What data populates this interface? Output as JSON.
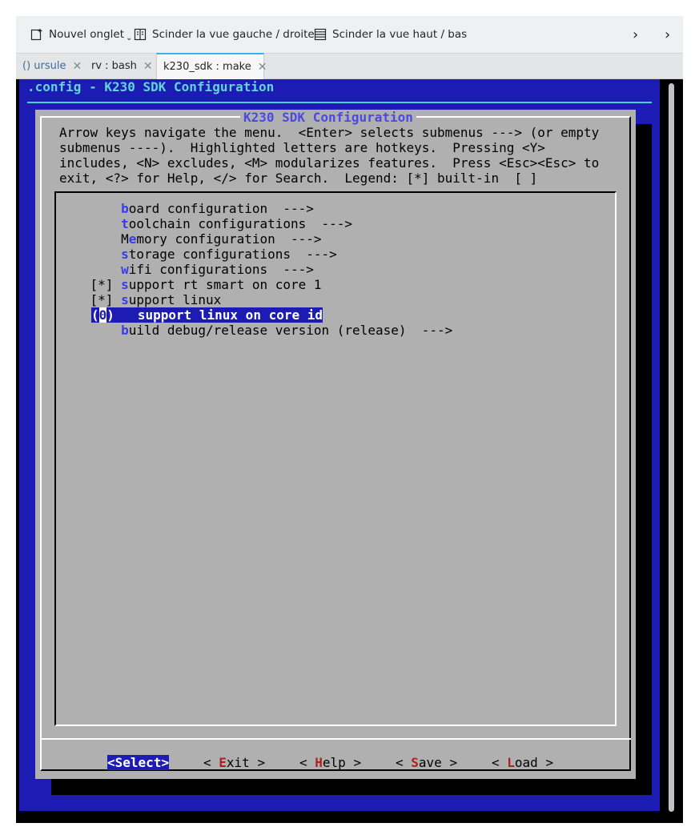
{
  "toolbar": {
    "new_tab": "Nouvel onglet",
    "new_tab_caret": "⌄",
    "split_lr": "Scinder la vue gauche / droite",
    "split_tb": "Scinder la vue haut / bas",
    "more_1": "›",
    "more_2": "›"
  },
  "tabs": [
    {
      "label": "() ursule",
      "close": "✕"
    },
    {
      "label": "rv : bash",
      "close": "✕"
    },
    {
      "label": "k230_sdk : make",
      "close": "✕"
    }
  ],
  "terminal": {
    "header_title": ".config - K230 SDK Configuration",
    "dialog_title": "K230 SDK Configuration",
    "help_lines": [
      "Arrow keys navigate the menu.  <Enter> selects submenus ---> (or empty",
      "submenus ----).  Highlighted letters are hotkeys.  Pressing <Y>",
      "includes, <N> excludes, <M> modularizes features.  Press <Esc><Esc> to",
      "exit, <?> for Help, </> for Search.  Legend: [*] built-in  [ ]"
    ],
    "menu_items": [
      {
        "prefix": "        ",
        "hotkey": "b",
        "rest": "oard configuration  --->"
      },
      {
        "prefix": "        ",
        "hotkey": "t",
        "rest": "oolchain configurations  --->"
      },
      {
        "prefix": "        M",
        "hotkey": "e",
        "rest": "mory configuration  --->"
      },
      {
        "prefix": "        ",
        "hotkey": "s",
        "rest": "torage configurations  --->"
      },
      {
        "prefix": "        ",
        "hotkey": "w",
        "rest": "ifi configurations  --->"
      },
      {
        "prefix": "    [*] ",
        "hotkey": "s",
        "rest": "upport rt smart on core 1"
      },
      {
        "prefix": "    [*] ",
        "hotkey": "s",
        "rest": "upport linux"
      },
      {
        "prefix": "    (",
        "cursor": "0",
        "mid": ")   ",
        "hotkey": "s",
        "rest": "upport linux on core id",
        "selected": true
      },
      {
        "prefix": "        ",
        "hotkey": "b",
        "rest": "uild debug/release version (release)  --->"
      }
    ],
    "buttons": [
      {
        "pre": "<",
        "hotkey": "S",
        "rest": "elect>",
        "active": true
      },
      {
        "pre": "< ",
        "hotkey": "E",
        "rest": "xit >"
      },
      {
        "pre": "< ",
        "hotkey": "H",
        "rest": "elp >"
      },
      {
        "pre": "< ",
        "hotkey": "S",
        "rest": "ave >"
      },
      {
        "pre": "< ",
        "hotkey": "L",
        "rest": "oad >"
      }
    ]
  }
}
